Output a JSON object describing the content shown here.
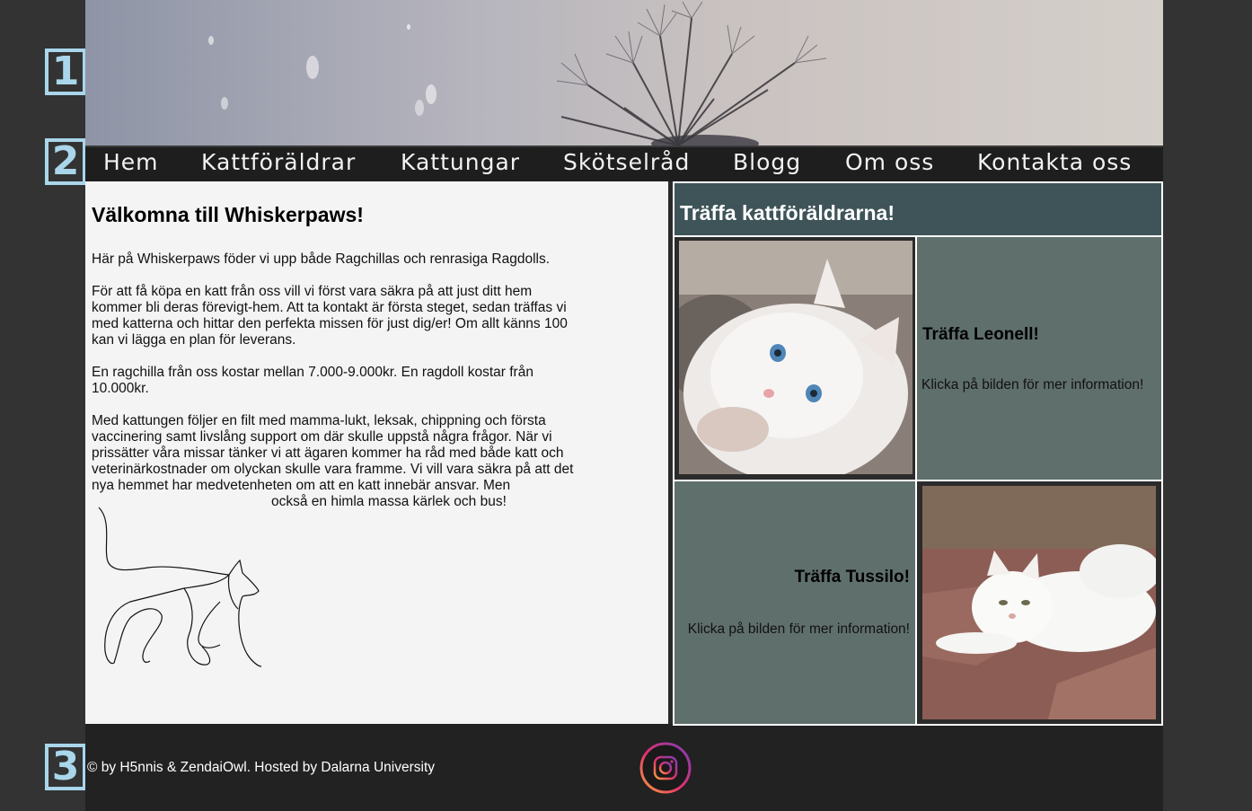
{
  "badges": {
    "b1": "1",
    "b2": "2",
    "b3": "3"
  },
  "nav": {
    "items": [
      {
        "label": "Hem"
      },
      {
        "label": "Kattföräldrar"
      },
      {
        "label": "Kattungar"
      },
      {
        "label": "Skötselråd"
      },
      {
        "label": "Blogg"
      },
      {
        "label": "Om oss"
      },
      {
        "label": "Kontakta oss"
      }
    ]
  },
  "main": {
    "title": "Välkomna till Whiskerpaws!",
    "paragraphs": [
      "Här på Whiskerpaws föder vi upp både Ragchillas och renrasiga Ragdolls.",
      "För att få köpa en katt från oss vill vi först vara säkra på att just ditt hem kommer bli deras förevigt-hem. Att ta kontakt är första steget, sedan träffas vi med katterna och hittar den perfekta missen för just dig/er! Om allt känns 100 kan vi lägga en plan för leverans.",
      "En ragchilla från oss kostar mellan 7.000-9.000kr. En ragdoll kostar från 10.000kr.",
      "Med kattungen följer en filt med mamma-lukt, leksak, chippning och första vaccinering samt livslång support om där skulle uppstå några frågor. När vi prissätter våra missar tänker vi att ägaren kommer ha råd med både katt och veterinärkostnader om olyckan skulle vara framme. Vi vill vara säkra på att det nya hemmet har medvetenheten om att en katt innebär ansvar. Men",
      "också en himla massa kärlek och bus!"
    ]
  },
  "aside": {
    "title": "Träffa kattföräldrarna!",
    "cats": [
      {
        "heading": "Träffa Leonell!",
        "hint": "Klicka på bilden för mer information!"
      },
      {
        "heading": "Träffa Tussilo!",
        "hint": "Klicka på bilden för mer information!"
      }
    ]
  },
  "footer": {
    "copyright": "© by H5nnis & ZendaiOwl. Hosted by Dalarna University",
    "icon": "instagram-icon"
  },
  "colors": {
    "background": "#333333",
    "nav": "#1e1e1e",
    "aside_header": "#3e5459",
    "cat_cell": "#5f6f6c",
    "badge": "#a9d6ea",
    "content": "#f4f4f4"
  }
}
